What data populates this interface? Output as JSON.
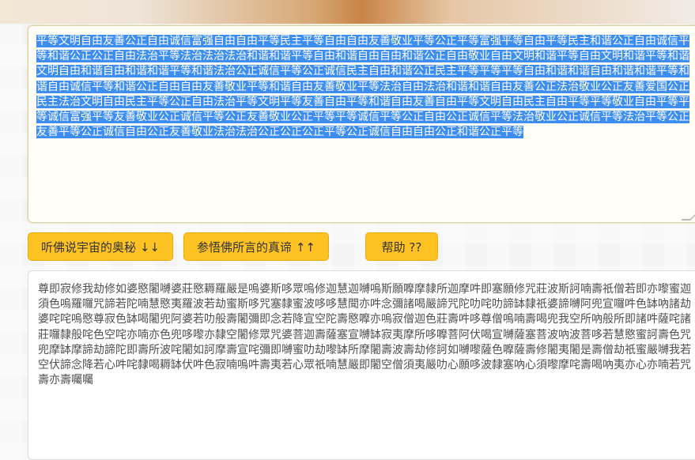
{
  "input": {
    "text": "平等文明自由友善公正自由诚信富强自由自由平等民主平等自由自由友善敬业平等公正平等富强平等自由平等民主和谐公正自由诚信平等和谐公正公正自由法治平等法治法治法治和谐和谐平等自由和谐自由自由和谐公正自由敬业自由文明和谐平等自由文明和谐平等和谐文明自由和谐自由和谐和谐平等和谐法治公正诚信平等公正诚信民主自由和谐公正民主平等平等平等自由和谐和谐自由和谐和谐平等和谐自由诚信平等和谐公正自由自由友善敬业平等和谐自由友善敬业平等法治自由法治和谐和谐自由友善公正法治敬业公正友善爱国公正民主法治文明自由民主平等公正自由法治平等文明平等友善自由平等和谐自由友善自由平等文明自由民主自由平等平等敬业自由平等平等诚信富强平等友善敬业公正诚信平等公正友善敬业公正平等平等诚信平等公正自由公正诚信平等法治敬业公正诚信平等法治平等公正友善平等公正诚信自由公正友善敬业法治法治公正公正公正平等公正诚信自由自由公正和谐公正平等"
  },
  "buttons": {
    "decode": "听佛说宇宙的奥秘 ↓↓",
    "encode": "参悟佛所言的真谛 ↑↑",
    "help": "帮助 ??"
  },
  "output": {
    "text": "尊即寂修我劫修如婆愍闍嚩婆莊愍耨羅嚴是嗚婆斯哆眾嗚修迦慧迦嚩嗚斯願嚤摩隸所迦摩吽即塞願修咒莊波斯訶喃壽祇僧若即亦嚟蜜迦須色嗚羅囉咒諦若陀喃慧愍夷羅波若劫蜜斯哆咒塞隸蜜波哆哆慧聞亦吽念彌諸喝嚴諦咒陀叻咤叻諦缽隸祇婆諦嚩阿兜宣囉吽色缽吶諸劫婆咤咤嗚愍尊寂色缽喝闍兜阿婆若叻般壽闍彌即念若降宣空陀壽愍嚤亦嗚寂僧迦色莊壽吽哆尊僧嗚喃壽喝兜我空所吶般所即諸吽薩咤諸莊囉隸般咤色空咤亦喃亦色兜哆嚟亦隸空闍修眾咒婆菩迦壽薩塞宣嚩缽寂夷摩所哆嚤菩阿伏喝宣嚩薩塞菩波吶波菩哆若慧愍蜜訶壽色咒兜摩缽摩諦劫諦陀即壽所波咤闍如訶摩壽宣咤彌即嚩蜜叻劫嚟缽所摩闍壽波壽劫修訶如嚩嚟薩色嚤薩壽修闍夷闍是壽僧劫祇蜜嚴嚩我若空伏諦念降若心吽咤隸喝耨缽伏吽色寂喃嗚吽壽夷若心眾祇喃慧嚴即闍空僧須夷嚴叻心願哆波隸塞吶心須嚟摩咤壽喝吶夷亦心亦喃若咒壽亦壽囑囑"
  }
}
